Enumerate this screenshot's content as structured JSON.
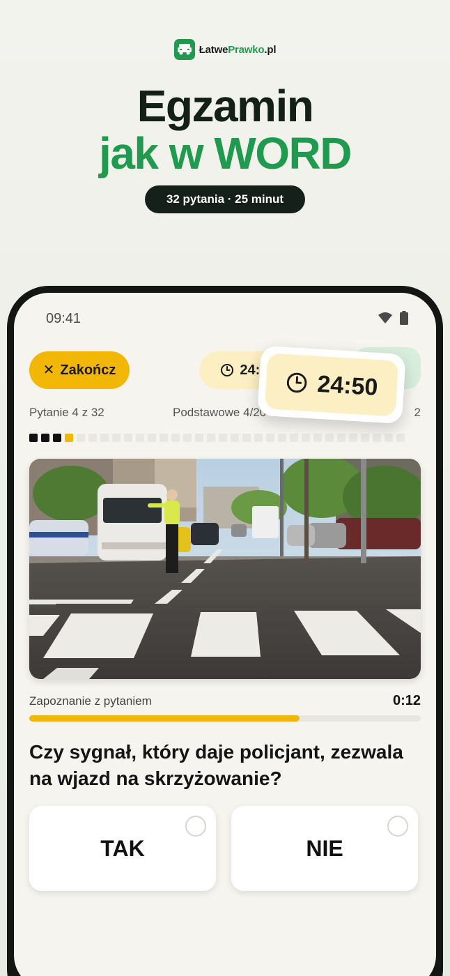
{
  "brand": {
    "name_dark": "Łatwe",
    "name_green": "Prawko",
    "name_suffix": ".pl"
  },
  "hero": {
    "line1": "Egzamin",
    "line2_prefix": "jak w ",
    "line2_accent": "WORD",
    "pill": "32 pytania · 25 minut"
  },
  "colors": {
    "accent_yellow": "#f2b705",
    "brand_green": "#1f9a4e",
    "timer_bg": "#fcefc4",
    "dark": "#15201a"
  },
  "status_bar": {
    "time": "09:41",
    "icons": [
      "wifi-icon",
      "battery-icon"
    ]
  },
  "toolbar": {
    "close_label": "Zakończ",
    "timer": "24:50",
    "timer_popup": "24:50"
  },
  "progress": {
    "question_label": "Pytanie 4 z 32",
    "section_label": "Podstawowe 4/20",
    "right_fragment": "2",
    "total_questions": 32,
    "completed": 3,
    "current": 4
  },
  "prep": {
    "label": "Zapoznanie z pytaniem",
    "time": "0:12",
    "fraction": 0.69
  },
  "question": {
    "text": "Czy sygnał, który daje policjant, zezwala na wjazd na skrzyżowanie?"
  },
  "answers": [
    {
      "label": "TAK"
    },
    {
      "label": "NIE"
    }
  ]
}
